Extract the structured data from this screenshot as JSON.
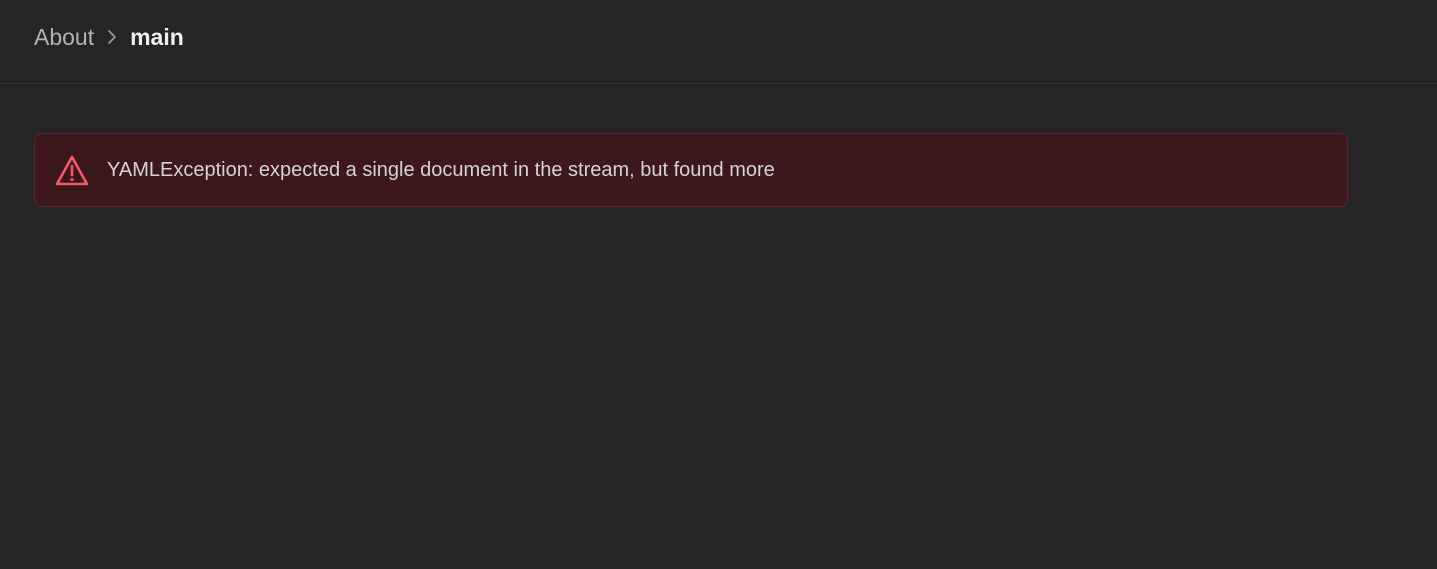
{
  "breadcrumb": {
    "parent": "About",
    "current": "main",
    "separator_icon": "chevron-right-icon"
  },
  "error": {
    "icon": "warning-triangle-icon",
    "message": "YAMLException: expected a single document in the stream, but found more"
  },
  "colors": {
    "background": "#252525",
    "error_background": "#3c181c",
    "error_border": "#5a262b",
    "error_icon": "#f05a64"
  }
}
